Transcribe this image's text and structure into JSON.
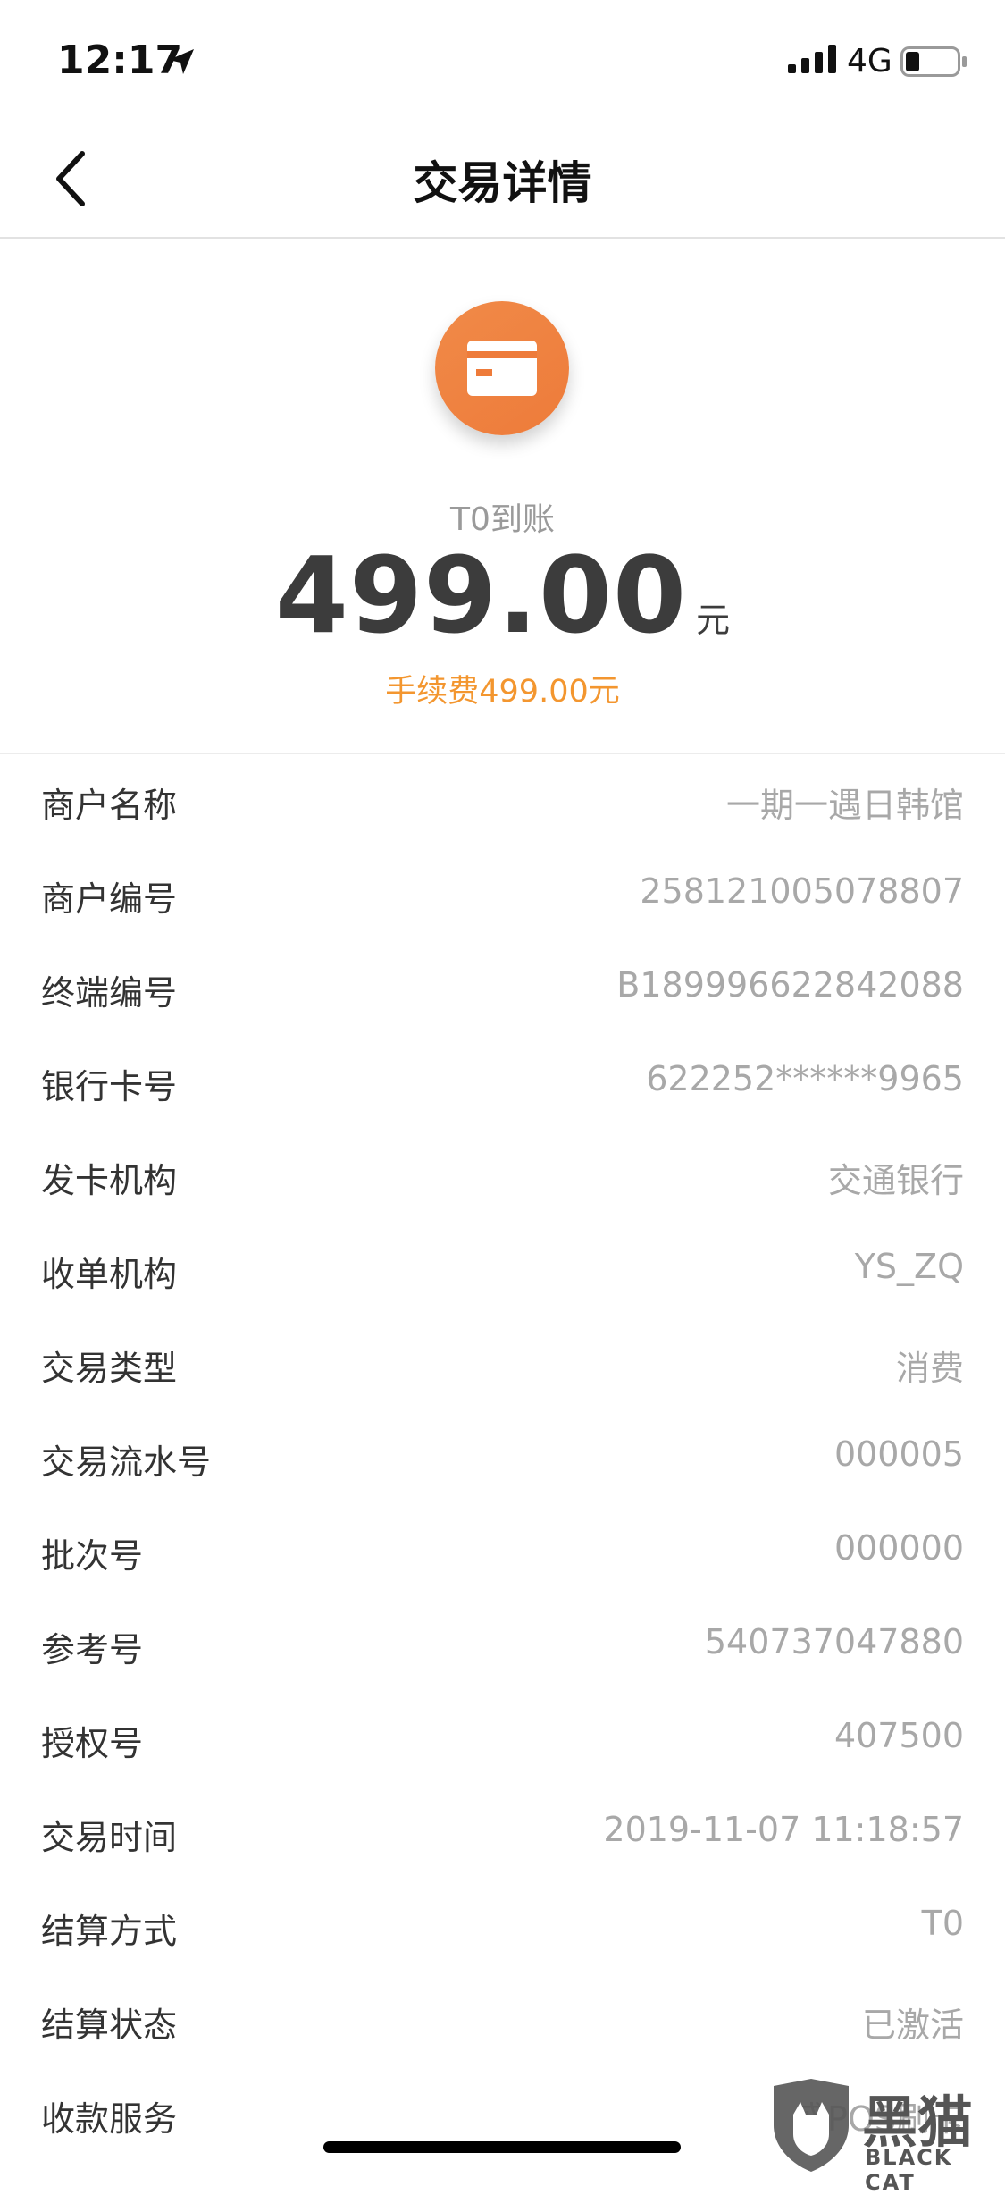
{
  "status_bar": {
    "time": "12:17",
    "network": "4G"
  },
  "nav": {
    "title": "交易详情"
  },
  "summary": {
    "arrival_label": "T0到账",
    "amount": "499.00",
    "unit": "元",
    "fee": "手续费499.00元"
  },
  "details": [
    {
      "label": "商户名称",
      "value": "一期一遇日韩馆"
    },
    {
      "label": "商户编号",
      "value": "258121005078807"
    },
    {
      "label": "终端编号",
      "value": "B189996622842088"
    },
    {
      "label": "银行卡号",
      "value": "622252******9965"
    },
    {
      "label": "发卡机构",
      "value": "交通银行"
    },
    {
      "label": "收单机构",
      "value": "YS_ZQ"
    },
    {
      "label": "交易类型",
      "value": "消费"
    },
    {
      "label": "交易流水号",
      "value": "000005"
    },
    {
      "label": "批次号",
      "value": "000000"
    },
    {
      "label": "参考号",
      "value": "540737047880"
    },
    {
      "label": "授权号",
      "value": "407500"
    },
    {
      "label": "交易时间",
      "value": "2019-11-07 11:18:57"
    },
    {
      "label": "结算方式",
      "value": "T0"
    },
    {
      "label": "结算状态",
      "value": "已激活"
    },
    {
      "label": "收款服务",
      "value": "盛POS刷卡"
    }
  ],
  "watermark": {
    "text": "黑猫",
    "sub": "BLACK CAT"
  },
  "colors": {
    "accent_orange": "#ee7b3a",
    "fee_orange": "#f3962f",
    "value_gray": "#a8a8a8"
  }
}
